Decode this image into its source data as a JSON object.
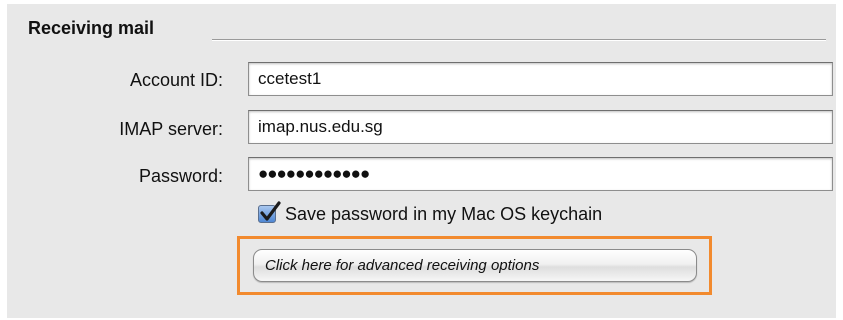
{
  "section": {
    "title": "Receiving mail"
  },
  "fields": {
    "account_id": {
      "label": "Account ID:",
      "value": "ccetest1"
    },
    "imap_server": {
      "label": "IMAP server:",
      "value": "imap.nus.edu.sg"
    },
    "password": {
      "label": "Password:",
      "masked_value": "●●●●●●●●●●●●"
    }
  },
  "save_password": {
    "label": "Save password in my Mac OS keychain",
    "checked": true
  },
  "advanced_button": {
    "label": "Click here for advanced receiving options"
  },
  "colors": {
    "highlight": "#f28a2e",
    "checkbox": "#4f87d3"
  }
}
